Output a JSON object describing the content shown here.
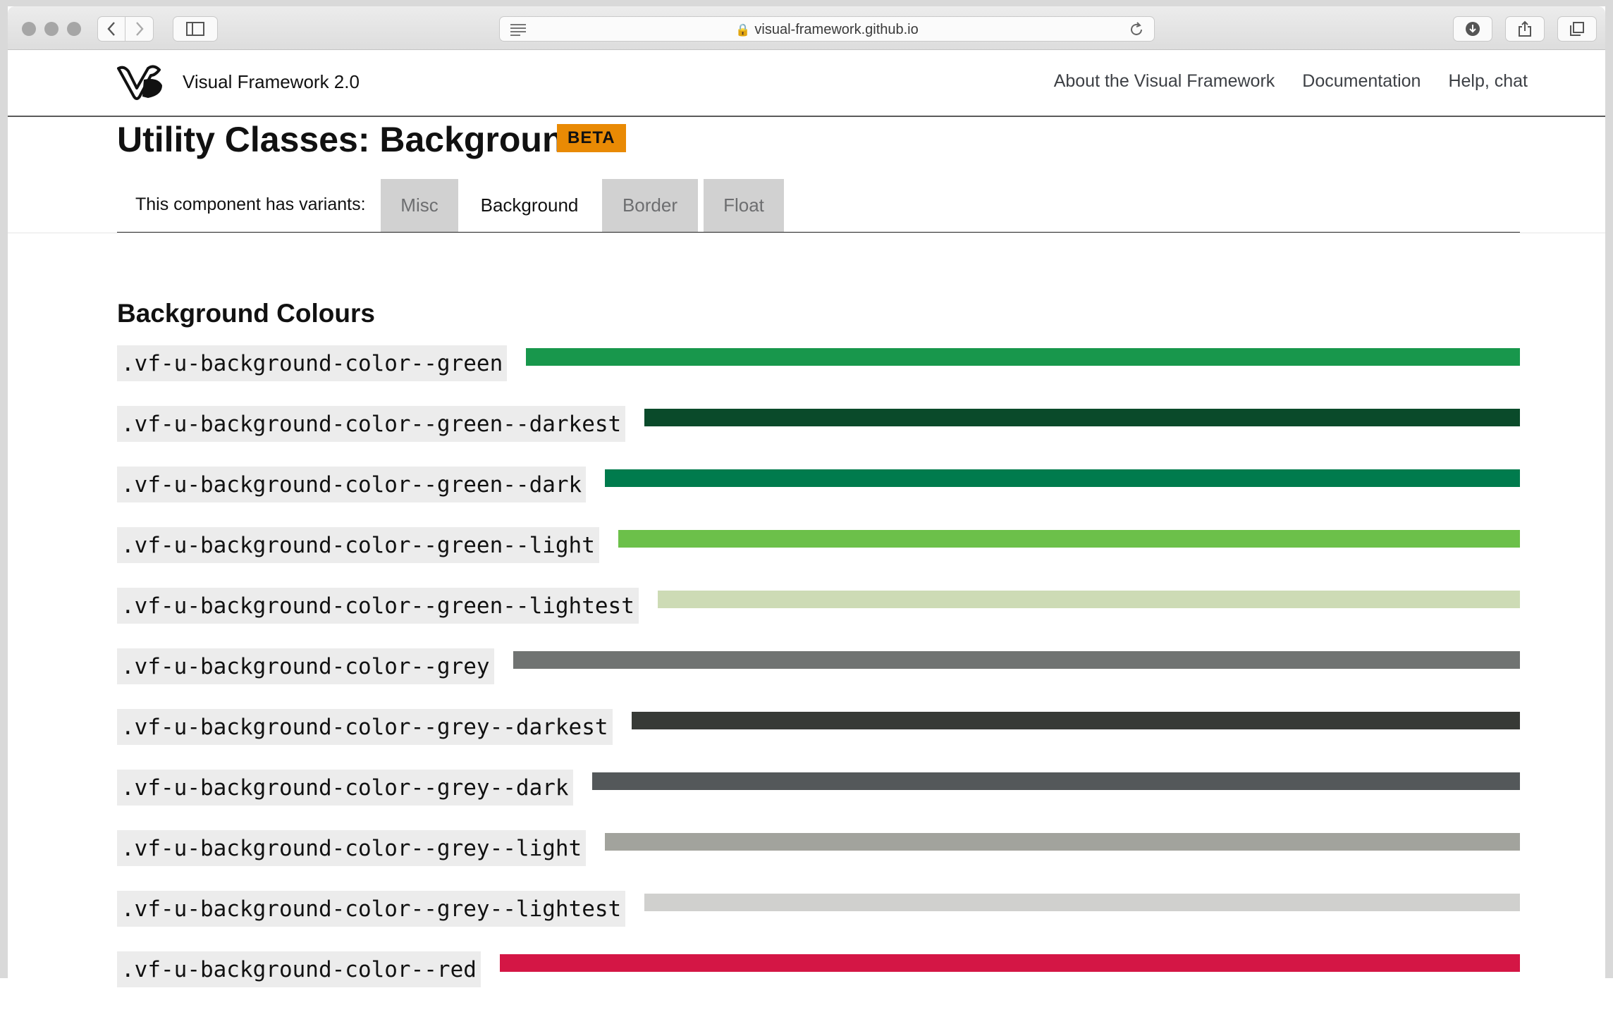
{
  "browser": {
    "url": "visual-framework.github.io"
  },
  "site": {
    "name": "Visual Framework 2.0",
    "nav": [
      "About the Visual Framework",
      "Documentation",
      "Help, chat"
    ]
  },
  "page": {
    "title": "Utility Classes: Background",
    "badge": "BETA",
    "variants_label": "This component has variants:",
    "tabs": [
      {
        "label": "Misc",
        "active": false
      },
      {
        "label": "Background",
        "active": true
      },
      {
        "label": "Border",
        "active": false
      },
      {
        "label": "Float",
        "active": false
      }
    ]
  },
  "section": {
    "heading": "Background Colours",
    "swatches": [
      {
        "class": ".vf-u-background-color--green",
        "color": "#18974c"
      },
      {
        "class": ".vf-u-background-color--green--darkest",
        "color": "#0a4a2a"
      },
      {
        "class": ".vf-u-background-color--green--dark",
        "color": "#007b4d"
      },
      {
        "class": ".vf-u-background-color--green--light",
        "color": "#6cc04a"
      },
      {
        "class": ".vf-u-background-color--green--lightest",
        "color": "#cddbb5"
      },
      {
        "class": ".vf-u-background-color--grey",
        "color": "#707372"
      },
      {
        "class": ".vf-u-background-color--grey--darkest",
        "color": "#373a36"
      },
      {
        "class": ".vf-u-background-color--grey--dark",
        "color": "#54585a"
      },
      {
        "class": ".vf-u-background-color--grey--light",
        "color": "#a2a39d"
      },
      {
        "class": ".vf-u-background-color--grey--lightest",
        "color": "#d0d0ce"
      },
      {
        "class": ".vf-u-background-color--red",
        "color": "#d41645"
      }
    ]
  }
}
